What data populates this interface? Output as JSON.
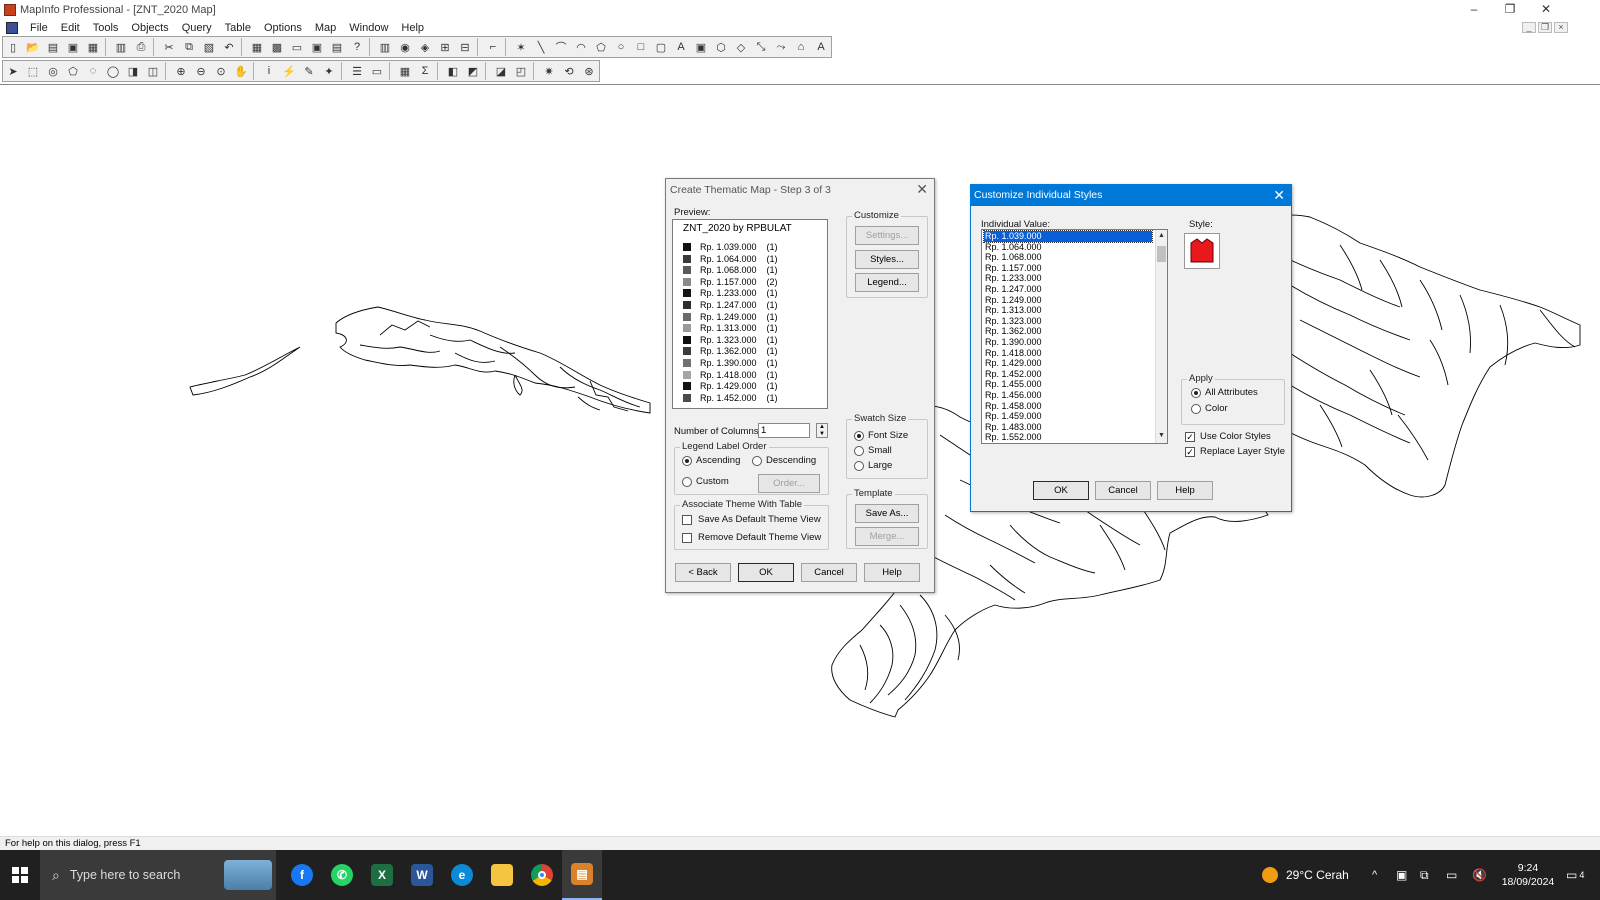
{
  "window": {
    "title": "MapInfo Professional - [ZNT_2020 Map]",
    "controls": [
      "–",
      "❐",
      "✕"
    ]
  },
  "menu": [
    "File",
    "Edit",
    "Tools",
    "Objects",
    "Query",
    "Table",
    "Options",
    "Map",
    "Window",
    "Help"
  ],
  "thematic_dialog": {
    "title": "Create Thematic Map - Step 3 of 3",
    "preview_label": "Preview:",
    "preview_title": "ZNT_2020 by RPBULAT",
    "preview_rows": [
      {
        "label": "Rp. 1.039.000",
        "count": "(1)",
        "color": "#111111"
      },
      {
        "label": "Rp. 1.064.000",
        "count": "(1)",
        "color": "#3a3a3a"
      },
      {
        "label": "Rp. 1.068.000",
        "count": "(1)",
        "color": "#5a5a5a"
      },
      {
        "label": "Rp. 1.157.000",
        "count": "(2)",
        "color": "#8a8a8a"
      },
      {
        "label": "Rp. 1.233.000",
        "count": "(1)",
        "color": "#141414"
      },
      {
        "label": "Rp. 1.247.000",
        "count": "(1)",
        "color": "#2e2e2e"
      },
      {
        "label": "Rp. 1.249.000",
        "count": "(1)",
        "color": "#6a6a6a"
      },
      {
        "label": "Rp. 1.313.000",
        "count": "(1)",
        "color": "#9a9a9a"
      },
      {
        "label": "Rp. 1.323.000",
        "count": "(1)",
        "color": "#0e0e0e"
      },
      {
        "label": "Rp. 1.362.000",
        "count": "(1)",
        "color": "#3c3c3c"
      },
      {
        "label": "Rp. 1.390.000",
        "count": "(1)",
        "color": "#707070"
      },
      {
        "label": "Rp. 1.418.000",
        "count": "(1)",
        "color": "#a5a5a5"
      },
      {
        "label": "Rp. 1.429.000",
        "count": "(1)",
        "color": "#121212"
      },
      {
        "label": "Rp. 1.452.000",
        "count": "(1)",
        "color": "#4a4a4a"
      }
    ],
    "customize_label": "Customize",
    "settings_label": "Settings...",
    "styles_label": "Styles...",
    "legend_label": "Legend...",
    "columns_label": "Number of Columns:",
    "columns_value": "1",
    "swatch_label": "Swatch Size",
    "swatch_font": "Font Size",
    "swatch_small": "Small",
    "swatch_large": "Large",
    "order_label": "Legend Label Order",
    "ascending": "Ascending",
    "descending": "Descending",
    "custom": "Custom",
    "order_btn": "Order...",
    "template_label": "Template",
    "save_as": "Save As...",
    "merge": "Merge...",
    "assoc_label": "Associate Theme With Table",
    "save_default": "Save As Default Theme View",
    "remove_default": "Remove Default Theme View",
    "back": "< Back",
    "ok": "OK",
    "cancel": "Cancel",
    "help": "Help"
  },
  "styles_dialog": {
    "title": "Customize Individual Styles",
    "value_label": "Individual Value:",
    "values": [
      "Rp. 1.039.000",
      "Rp. 1.064.000",
      "Rp. 1.068.000",
      "Rp. 1.157.000",
      "Rp. 1.233.000",
      "Rp. 1.247.000",
      "Rp. 1.249.000",
      "Rp. 1.313.000",
      "Rp. 1.323.000",
      "Rp. 1.362.000",
      "Rp. 1.390.000",
      "Rp. 1.418.000",
      "Rp. 1.429.000",
      "Rp. 1.452.000",
      "Rp. 1.455.000",
      "Rp. 1.456.000",
      "Rp. 1.458.000",
      "Rp. 1.459.000",
      "Rp. 1.483.000",
      "Rp. 1.552.000"
    ],
    "selected_index": 0,
    "style_label": "Style:",
    "style_color": "#e8181c",
    "apply_label": "Apply",
    "all_attributes": "All Attributes",
    "color": "Color",
    "use_color": "Use Color Styles",
    "replace_layer": "Replace Layer Style",
    "ok": "OK",
    "cancel": "Cancel",
    "help": "Help"
  },
  "status": "For help on this dialog, press F1",
  "taskbar": {
    "search_placeholder": "Type here to search",
    "weather": "29°C  Cerah",
    "time": "9:24",
    "date": "18/09/2024",
    "notification_count": "4"
  }
}
